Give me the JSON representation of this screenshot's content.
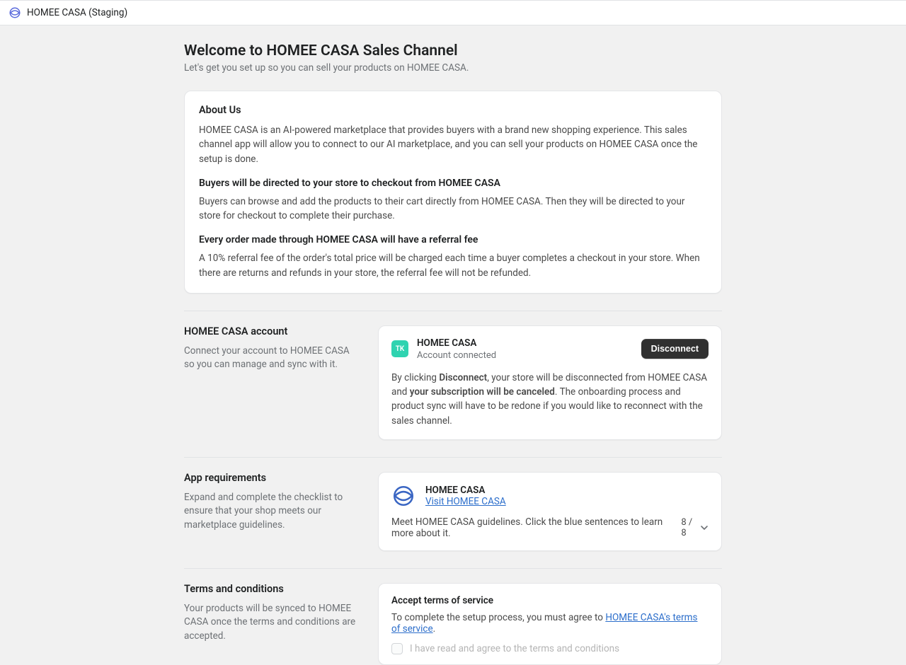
{
  "topbar": {
    "title": "HOMEE CASA (Staging)"
  },
  "page": {
    "title": "Welcome to HOMEE CASA Sales Channel",
    "subtitle": "Let's get you set up so you can sell your products on HOMEE CASA."
  },
  "about": {
    "heading": "About Us",
    "p1": "HOMEE CASA is an AI-powered marketplace that provides buyers with a brand new shopping experience. This sales channel app will allow you to connect to our AI marketplace, and you can sell your products on HOMEE CASA once the setup is done.",
    "h2": "Buyers will be directed to your store to checkout from HOMEE CASA",
    "p2": "Buyers can browse and add the products to their cart directly from HOMEE CASA. Then they will be directed to your store for checkout to complete their purchase.",
    "h3": "Every order made through HOMEE CASA will have a referral fee",
    "p3": "A 10% referral fee of the order's total price will be charged each time a buyer completes a checkout in your store. When there are returns and refunds in your store, the referral fee will not be refunded."
  },
  "account": {
    "left_title": "HOMEE CASA account",
    "left_desc": "Connect your account to HOMEE CASA so you can manage and sync with it.",
    "avatar_initials": "TK",
    "name": "HOMEE CASA",
    "status": "Account connected",
    "disconnect_label": "Disconnect",
    "warn_prefix": "By clicking ",
    "warn_bold1": "Disconnect",
    "warn_mid": ", your store will be disconnected from HOMEE CASA and ",
    "warn_bold2": "your subscription will be canceled",
    "warn_suffix": ". The onboarding process and product sync will have to be redone if you would like to reconnect with the sales channel."
  },
  "requirements": {
    "left_title": "App requirements",
    "left_desc": "Expand and complete the checklist to ensure that your shop meets our marketplace guidelines.",
    "name": "HOMEE CASA",
    "visit_label": "Visit HOMEE CASA",
    "desc": "Meet HOMEE CASA guidelines. Click the blue sentences to learn more about it.",
    "count": "8 / 8"
  },
  "tos": {
    "left_title": "Terms and conditions",
    "left_desc": "Your products will be synced to HOMEE CASA once the terms and conditions are accepted.",
    "card_title": "Accept terms of service",
    "text_prefix": "To complete the setup process, you must agree to ",
    "link_label": "HOMEE CASA's terms of service",
    "text_suffix": ".",
    "check_label": "I have read and agree to the terms and conditions"
  }
}
